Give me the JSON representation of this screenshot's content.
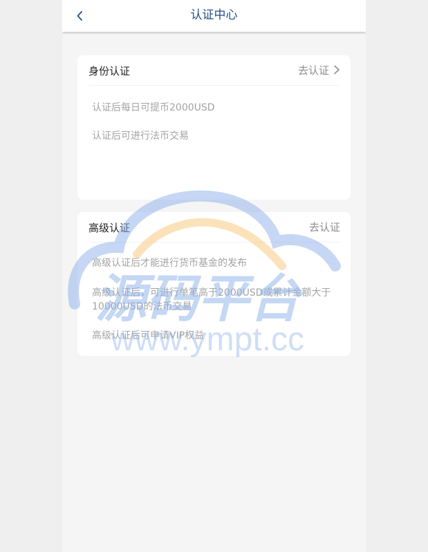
{
  "header": {
    "title": "认证中心"
  },
  "cards": [
    {
      "title": "身份认证",
      "action_label": "去认证",
      "items": [
        "认证后每日可提币2000USD",
        "认证后可进行法币交易"
      ]
    },
    {
      "title": "高级认证",
      "action_label": "去认证",
      "items": [
        "高级认证后才能进行货币基金的发布",
        "高级认证后，可进行单笔高于2000USD或累计金额大于10000USD的法币交易",
        "高级认证后可申请VIP权益"
      ]
    }
  ],
  "watermark": {
    "main_text": "源码平台",
    "sub_text": "www.ympt.cc"
  },
  "colors": {
    "header_title": "#1f4f8a",
    "item_text": "#a3a3a3",
    "watermark_blue": "#8fb2ea",
    "watermark_orange": "#f7c97c"
  }
}
